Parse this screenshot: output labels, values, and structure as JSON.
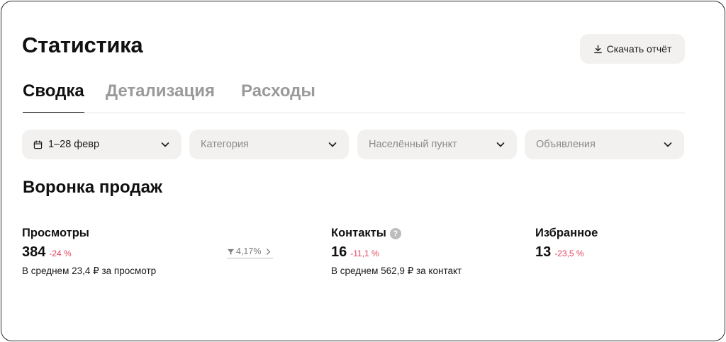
{
  "header": {
    "title": "Статистика",
    "download_label": "Скачать отчёт"
  },
  "tabs": [
    {
      "label": "Сводка",
      "active": true
    },
    {
      "label": "Детализация",
      "active": false
    },
    {
      "label": "Расходы",
      "active": false
    }
  ],
  "filters": {
    "period": {
      "value": "1–28 февр"
    },
    "category": {
      "placeholder": "Категория"
    },
    "locality": {
      "placeholder": "Населённый пункт"
    },
    "listings": {
      "placeholder": "Объявления"
    }
  },
  "funnel": {
    "title": "Воронка продаж",
    "views": {
      "label": "Просмотры",
      "value": "384",
      "delta": "-24 %",
      "note": "В среднем 23,4 ₽ за просмотр"
    },
    "conversion": "4,17%",
    "contacts": {
      "label": "Контакты",
      "value": "16",
      "delta": "-11,1 %",
      "note": "В среднем 562,9 ₽ за контакт"
    },
    "favorites": {
      "label": "Избранное",
      "value": "13",
      "delta": "-23,5 %"
    }
  },
  "colors": {
    "negative": "#e2455c",
    "control_bg": "#f2f1ef",
    "muted": "#9a9a9a"
  }
}
